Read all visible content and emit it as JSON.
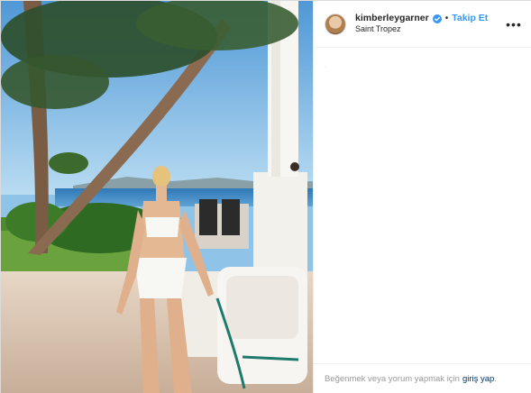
{
  "header": {
    "username": "kimberleygarner",
    "follow_label": "Takip Et",
    "separator": "•",
    "location": "Saint Tropez",
    "more_label": "•••"
  },
  "footer": {
    "prompt": "Beğenmek veya yorum yapmak için",
    "login_label": "giriş yap",
    "end": "."
  },
  "colors": {
    "link_blue": "#3897f0",
    "login_navy": "#003569",
    "muted": "#999999",
    "border": "#dbdbdb"
  },
  "icons": [
    "verified-badge-icon",
    "more-options-icon"
  ]
}
